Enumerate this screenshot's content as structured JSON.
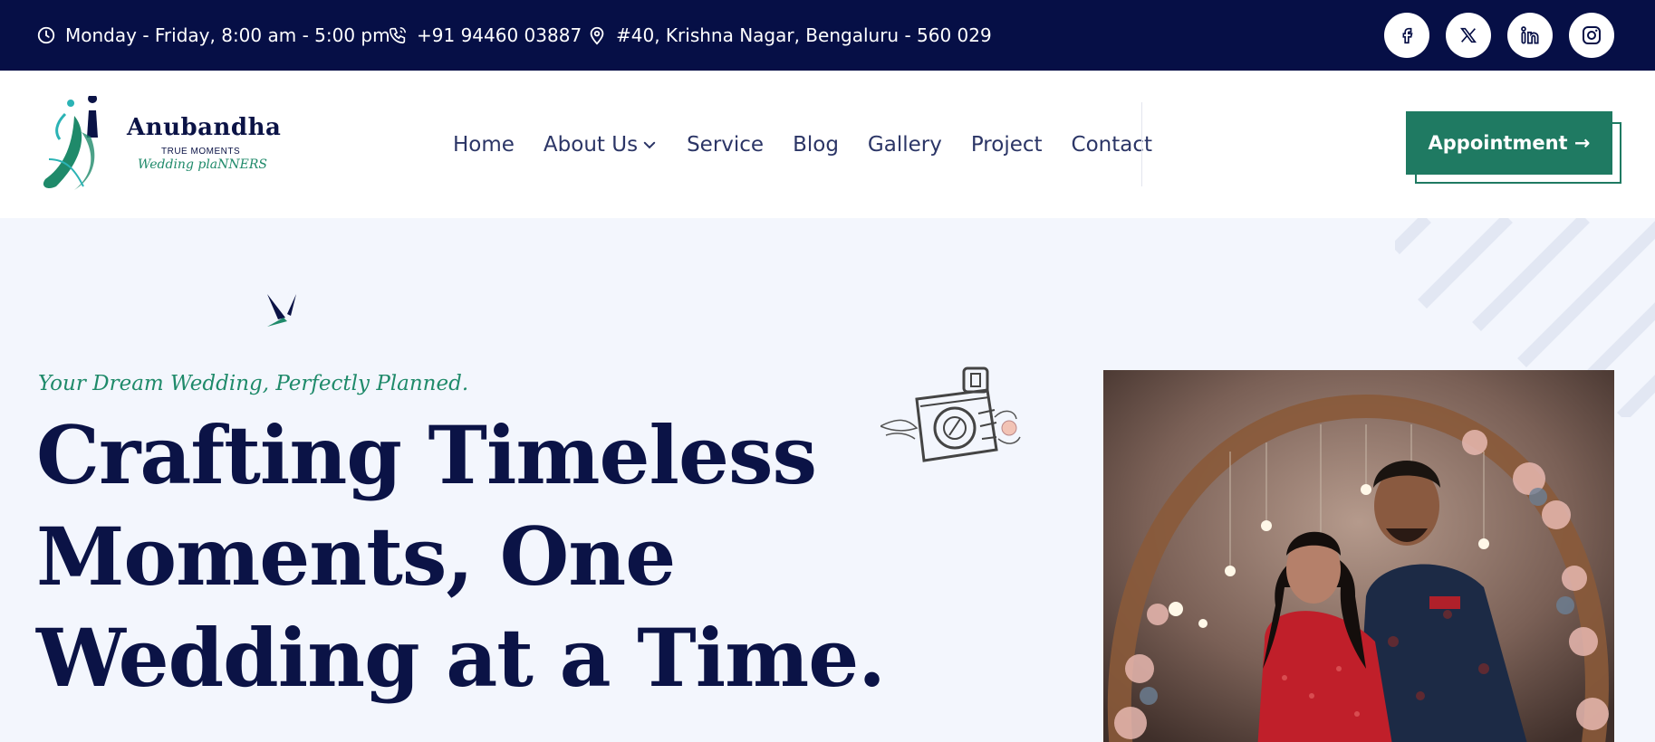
{
  "topbar": {
    "hours": "Monday - Friday, 8:00 am - 5:00 pm",
    "phone": "+91 94460 03887",
    "address": "#40, Krishna Nagar, Bengaluru - 560 029",
    "social": [
      "facebook-icon",
      "x-icon",
      "linkedin-icon",
      "instagram-icon"
    ]
  },
  "logo": {
    "name": "Anubandha",
    "line1": "TRUE MOMENTS",
    "line2": "Wedding plaNNERS"
  },
  "nav": {
    "items": [
      "Home",
      "About Us",
      "Service",
      "Blog",
      "Gallery",
      "Project",
      "Contact"
    ]
  },
  "cta": {
    "label": "Appointment →"
  },
  "hero": {
    "tagline": "Your Dream Wedding, Perfectly Planned.",
    "headline": "Crafting Timeless Moments, One Wedding at a Time."
  },
  "colors": {
    "navy": "#060f46",
    "green": "#1f7a62",
    "background": "#f3f6fd"
  }
}
